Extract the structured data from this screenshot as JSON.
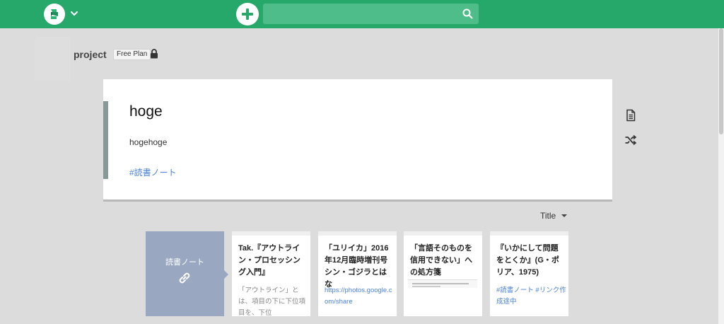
{
  "header": {
    "search_placeholder": ""
  },
  "project": {
    "name": "project",
    "plan": "Free Plan"
  },
  "page": {
    "title": "hoge",
    "body": "hogehoge",
    "tag": "#読書ノート"
  },
  "sort": {
    "label": "Title"
  },
  "related": {
    "tag_card_label": "読書ノート",
    "cards": [
      {
        "title": "Tak.『アウトライン・プロセッシング入門』",
        "desc": "「アウトライン」とは、項目の下に下位項目を、下位"
      },
      {
        "title": "「ユリイカ」2016年12月臨時増刊号 シン・ゴジラとはな",
        "link": "https://photos.google.com/share"
      },
      {
        "title": "「言語そのものを信用できない」への処方箋"
      },
      {
        "title": "『いかにして問題をとくか』(G・ポリア、1975)",
        "tags": "#読書ノート #リンク作成途中"
      }
    ]
  },
  "colors": {
    "brand": "#27a86b",
    "tag_card": "#99a8c0",
    "link": "#4a82d6"
  }
}
